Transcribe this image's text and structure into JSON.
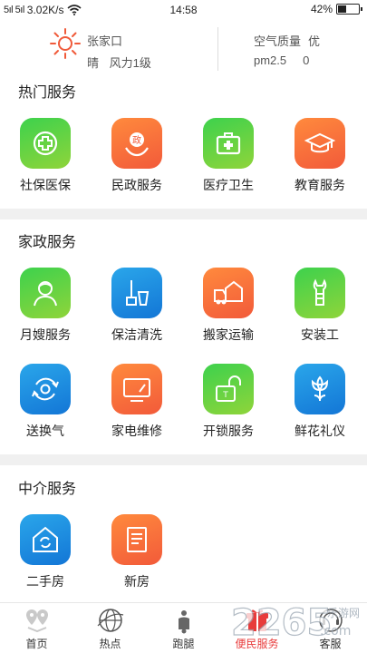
{
  "status_bar": {
    "signal_text": "5ıl 5ıl",
    "network_speed": "3.02K/s",
    "time": "14:58",
    "battery": "42%",
    "battery_level": 0.42
  },
  "weather": {
    "city": "张家口",
    "condition": "晴",
    "wind": "风力1级",
    "air_quality_label": "空气质量",
    "air_quality_value": "优",
    "pm_label": "pm2.5",
    "pm_value": "0",
    "icon": "sun-icon"
  },
  "sections": [
    {
      "title": "热门服务",
      "items": [
        {
          "label": "社保医保",
          "icon": "medical-cross-icon",
          "color": "green"
        },
        {
          "label": "民政服务",
          "icon": "civil-affairs-icon",
          "color": "orange"
        },
        {
          "label": "医疗卫生",
          "icon": "medical-kit-icon",
          "color": "green"
        },
        {
          "label": "教育服务",
          "icon": "graduation-cap-icon",
          "color": "orange"
        }
      ]
    },
    {
      "title": "家政服务",
      "items": [
        {
          "label": "月嫂服务",
          "icon": "nanny-icon",
          "color": "green"
        },
        {
          "label": "保洁清洗",
          "icon": "mop-bucket-icon",
          "color": "blue"
        },
        {
          "label": "搬家运输",
          "icon": "moving-truck-icon",
          "color": "orange"
        },
        {
          "label": "安装工",
          "icon": "wrench-hand-icon",
          "color": "green"
        },
        {
          "label": "送换气",
          "icon": "gas-exchange-icon",
          "color": "blue"
        },
        {
          "label": "家电维修",
          "icon": "tv-repair-icon",
          "color": "orange"
        },
        {
          "label": "开锁服务",
          "icon": "unlock-icon",
          "color": "green"
        },
        {
          "label": "鲜花礼仪",
          "icon": "flower-icon",
          "color": "blue"
        }
      ]
    },
    {
      "title": "中介服务",
      "items": [
        {
          "label": "二手房",
          "icon": "second-hand-house-icon",
          "color": "blue"
        },
        {
          "label": "新房",
          "icon": "new-house-doc-icon",
          "color": "orange"
        }
      ]
    }
  ],
  "tabs": [
    {
      "label": "首页",
      "icon": "home-map-pin-icon",
      "active": false
    },
    {
      "label": "热点",
      "icon": "globe-icon",
      "active": false
    },
    {
      "label": "跑腿",
      "icon": "scooter-icon",
      "active": false
    },
    {
      "label": "便民服务",
      "icon": "gift-service-icon",
      "active": true
    },
    {
      "label": "客服",
      "icon": "customer-service-icon",
      "active": false
    }
  ],
  "watermark": {
    "text": "2265",
    "suffix": ".com",
    "side": "乐游网"
  },
  "colors": {
    "green_start": "#3dd24d",
    "green_end": "#8fd43a",
    "orange_start": "#ff8a3d",
    "orange_end": "#f25a3a",
    "blue_start": "#2aa6ea",
    "blue_end": "#1376d6",
    "active_tab": "#e83b3b",
    "section_gap": "#f0f0f0"
  }
}
